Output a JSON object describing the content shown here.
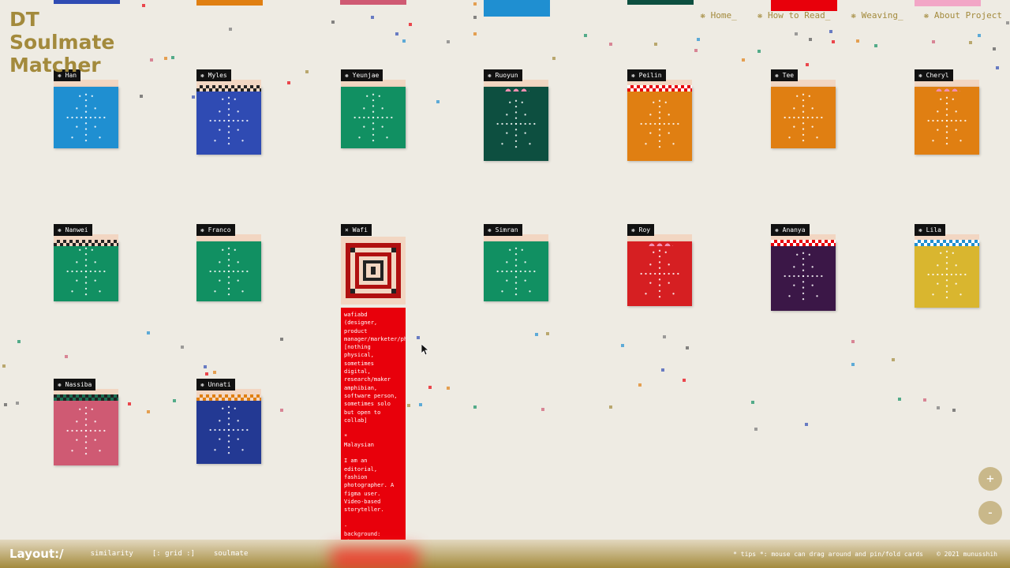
{
  "logo": {
    "line1": "DT",
    "line2": "Soulmate",
    "line3": "Matcher"
  },
  "nav": [
    {
      "label": "❋ Home_"
    },
    {
      "label": "❋ How to Read_"
    },
    {
      "label": "❋ Weaving_"
    },
    {
      "label": "❋ About Project"
    }
  ],
  "cards": [
    {
      "name": "❋ Han",
      "color": "#1f8fd1",
      "band": "none"
    },
    {
      "name": "❋ Myles",
      "color": "#2f4bb3",
      "band": "check-dark"
    },
    {
      "name": "❋ Yeunjae",
      "color": "#119062",
      "band": "none"
    },
    {
      "name": "❋ Ruoyun",
      "color": "#0d4f40",
      "band": "pink"
    },
    {
      "name": "❋ Peilin",
      "color": "#e07f12",
      "band": "check-red"
    },
    {
      "name": "❋ Tee",
      "color": "#e07f12",
      "band": "none"
    },
    {
      "name": "❋ Cheryl",
      "color": "#e07f12",
      "band": "pink"
    },
    {
      "name": "❋ Nanwei",
      "color": "#119062",
      "band": "check-dark"
    },
    {
      "name": "❋ Franco",
      "color": "#119062",
      "band": "none"
    },
    {
      "name": "× Wafi",
      "color": "#e8000b",
      "band": "none"
    },
    {
      "name": "❋ Simran",
      "color": "#119062",
      "band": "none"
    },
    {
      "name": "❋ Roy",
      "color": "#d61f22",
      "band": "pink"
    },
    {
      "name": "❋ Ananya",
      "color": "#3b1747",
      "band": "check-red"
    },
    {
      "name": "❋ Lila",
      "color": "#d9b62f",
      "band": "check-blue"
    },
    {
      "name": "❋ Nassiba",
      "color": "#cf5a73",
      "band": "check-green"
    },
    {
      "name": "❋ Unnati",
      "color": "#233993",
      "band": "check-orange"
    }
  ],
  "popup": {
    "text": "wafiabd\n(designer, product manager/marketer/photographer)\n[nothing physical, sometimes digital, research/maker amphibian, software person, sometimes solo but open to collab]\n\n*\nMalaysian\n\nI am an editorial, fashion photographer. A figma user. Video-based storyteller.\n\n-\nbackground:\nPhotography, filmmaking, marketing, sales\n\nfav artist:"
  },
  "bottom": {
    "layout_label": "Layout:/",
    "options": [
      "similarity",
      "[: grid :]",
      "soulmate"
    ],
    "tips": "* tips *: mouse can drag around and pin/fold cards",
    "copyright": "© 2021 munusshih"
  },
  "zoom": {
    "plus": "+",
    "minus": "-"
  },
  "colors": {
    "gold": "#a38a3c",
    "background": "#eeebe3"
  }
}
